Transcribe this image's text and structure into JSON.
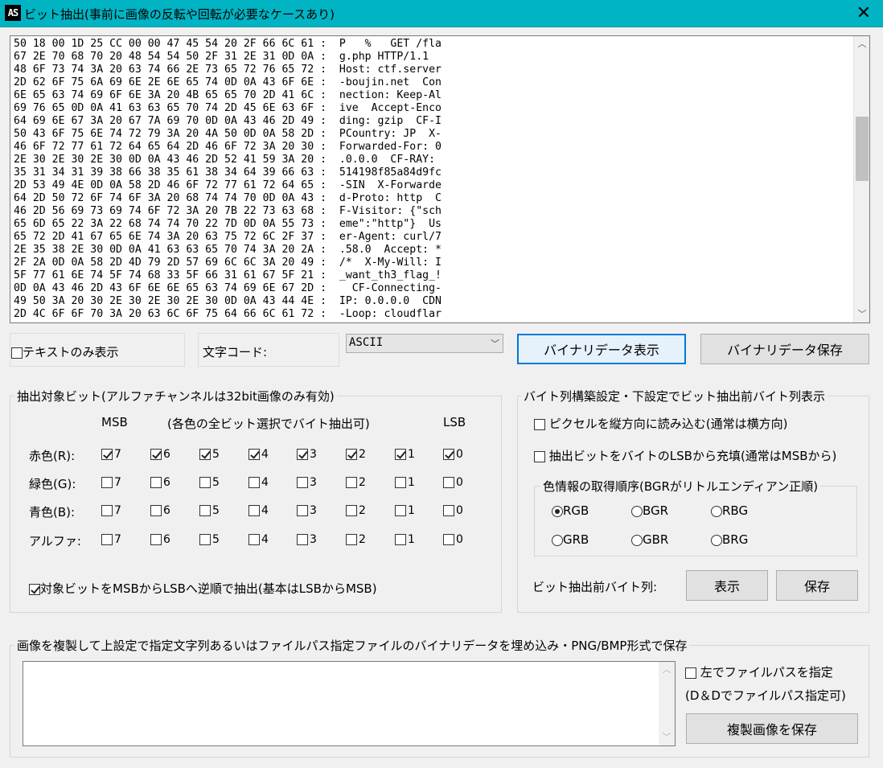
{
  "window": {
    "icon_text": "AS",
    "title": "ビット抽出(事前に画像の反転や回転が必要なケースあり)",
    "close_glyph": "✕"
  },
  "dump": {
    "lines": [
      "50 18 00 1D 25 CC 00 00 47 45 54 20 2F 66 6C 61 :  P   %   GET /fla",
      "67 2E 70 68 70 20 48 54 54 50 2F 31 2E 31 0D 0A :  g.php HTTP/1.1",
      "48 6F 73 74 3A 20 63 74 66 2E 73 65 72 76 65 72 :  Host: ctf.server",
      "2D 62 6F 75 6A 69 6E 2E 6E 65 74 0D 0A 43 6F 6E :  -boujin.net  Con",
      "6E 65 63 74 69 6F 6E 3A 20 4B 65 65 70 2D 41 6C :  nection: Keep-Al",
      "69 76 65 0D 0A 41 63 63 65 70 74 2D 45 6E 63 6F :  ive  Accept-Enco",
      "64 69 6E 67 3A 20 67 7A 69 70 0D 0A 43 46 2D 49 :  ding: gzip  CF-I",
      "50 43 6F 75 6E 74 72 79 3A 20 4A 50 0D 0A 58 2D :  PCountry: JP  X-",
      "46 6F 72 77 61 72 64 65 64 2D 46 6F 72 3A 20 30 :  Forwarded-For: 0",
      "2E 30 2E 30 2E 30 0D 0A 43 46 2D 52 41 59 3A 20 :  .0.0.0  CF-RAY:",
      "35 31 34 31 39 38 66 38 35 61 38 34 64 39 66 63 :  514198f85a84d9fc",
      "2D 53 49 4E 0D 0A 58 2D 46 6F 72 77 61 72 64 65 :  -SIN  X-Forwarde",
      "64 2D 50 72 6F 74 6F 3A 20 68 74 74 70 0D 0A 43 :  d-Proto: http  C",
      "46 2D 56 69 73 69 74 6F 72 3A 20 7B 22 73 63 68 :  F-Visitor: {\"sch",
      "65 6D 65 22 3A 22 68 74 74 70 22 7D 0D 0A 55 73 :  eme\":\"http\"}  Us",
      "65 72 2D 41 67 65 6E 74 3A 20 63 75 72 6C 2F 37 :  er-Agent: curl/7",
      "2E 35 38 2E 30 0D 0A 41 63 63 65 70 74 3A 20 2A :  .58.0  Accept: *",
      "2F 2A 0D 0A 58 2D 4D 79 2D 57 69 6C 6C 3A 20 49 :  /*  X-My-Will: I",
      "5F 77 61 6E 74 5F 74 68 33 5F 66 31 61 67 5F 21 :  _want_th3_flag_!",
      "0D 0A 43 46 2D 43 6F 6E 6E 65 63 74 69 6E 67 2D :    CF-Connecting-",
      "49 50 3A 20 30 2E 30 2E 30 2E 30 0D 0A 43 44 4E :  IP: 0.0.0.0  CDN",
      "2D 4C 6F 6F 70 3A 20 63 6C 6F 75 64 66 6C 61 72 :  -Loop: cloudflar"
    ]
  },
  "controls_row": {
    "text_only_label": "テキストのみ表示",
    "charcode_label": "文字コード:",
    "charcode_value": "ASCII",
    "show_binary_button": "バイナリデータ表示",
    "save_binary_button": "バイナリデータ保存"
  },
  "bits": {
    "group_label": "抽出対象ビット(アルファチャンネルは32bit画像のみ有効)",
    "msb": "MSB",
    "note": "(各色の全ビット選択でバイト抽出可)",
    "lsb": "LSB",
    "bit_numbers": [
      "7",
      "6",
      "5",
      "4",
      "3",
      "2",
      "1",
      "0"
    ],
    "rows": [
      {
        "label": "赤色(R):",
        "checked": [
          true,
          true,
          true,
          true,
          true,
          true,
          true,
          true
        ]
      },
      {
        "label": "緑色(G):",
        "checked": [
          false,
          false,
          false,
          false,
          false,
          false,
          false,
          false
        ]
      },
      {
        "label": "青色(B):",
        "checked": [
          false,
          false,
          false,
          false,
          false,
          false,
          false,
          false
        ]
      },
      {
        "label": "アルファ:",
        "checked": [
          false,
          false,
          false,
          false,
          false,
          false,
          false,
          false
        ]
      }
    ],
    "reverse_label": "対象ビットをMSBからLSBへ逆順で抽出(基本はLSBからMSB)",
    "reverse_checked": true
  },
  "byteseq": {
    "group_label": "バイト列構築設定・下設定でビット抽出前バイト列表示",
    "vertical_label": "ピクセルを縦方向に読み込む(通常は横方向)",
    "lsb_fill_label": "抽出ビットをバイトのLSBから充填(通常はMSBから)",
    "order_group_label": "色情報の取得順序(BGRがリトルエンディアン正順)",
    "orders": [
      "RGB",
      "BGR",
      "RBG",
      "GRB",
      "GBR",
      "BRG"
    ],
    "selected_order": "RGB",
    "pre_label": "ビット抽出前バイト列:",
    "show_button": "表示",
    "save_button": "保存"
  },
  "embed": {
    "group_label": "画像を複製して上設定で指定文字列あるいはファイルパス指定ファイルのバイナリデータを埋め込み・PNG/BMP形式で保存",
    "input_value": "",
    "filepath_label": "左でファイルパスを指定",
    "dnd_hint": "(D＆Dでファイルパス指定可)",
    "save_button": "複製画像を保存"
  }
}
